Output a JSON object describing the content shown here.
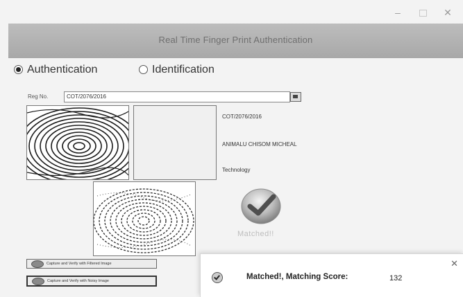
{
  "window": {
    "title": "Real Time Finger Print Authentication",
    "controls": {
      "minimize": "–",
      "close": "✕"
    }
  },
  "modes": {
    "authentication": "Authentication",
    "identification": "Identification",
    "selected": "authentication"
  },
  "reg": {
    "label": "Reg No.",
    "value": "COT/2076/2016"
  },
  "student": {
    "reg_no": "COT/2076/2016",
    "name": "ANIMALU CHISOM MICHEAL",
    "department": "Technology"
  },
  "match": {
    "caption": "Matched!!",
    "icon": "checkmark-icon"
  },
  "buttons": {
    "capture_filtered": "Capture and Verify with Filtered Image",
    "capture_noisy": "Capture and Verify with Noisy Image"
  },
  "dialog": {
    "close": "✕",
    "message": "Matched!, Matching Score:",
    "score": "132",
    "icon": "info-check-icon"
  }
}
